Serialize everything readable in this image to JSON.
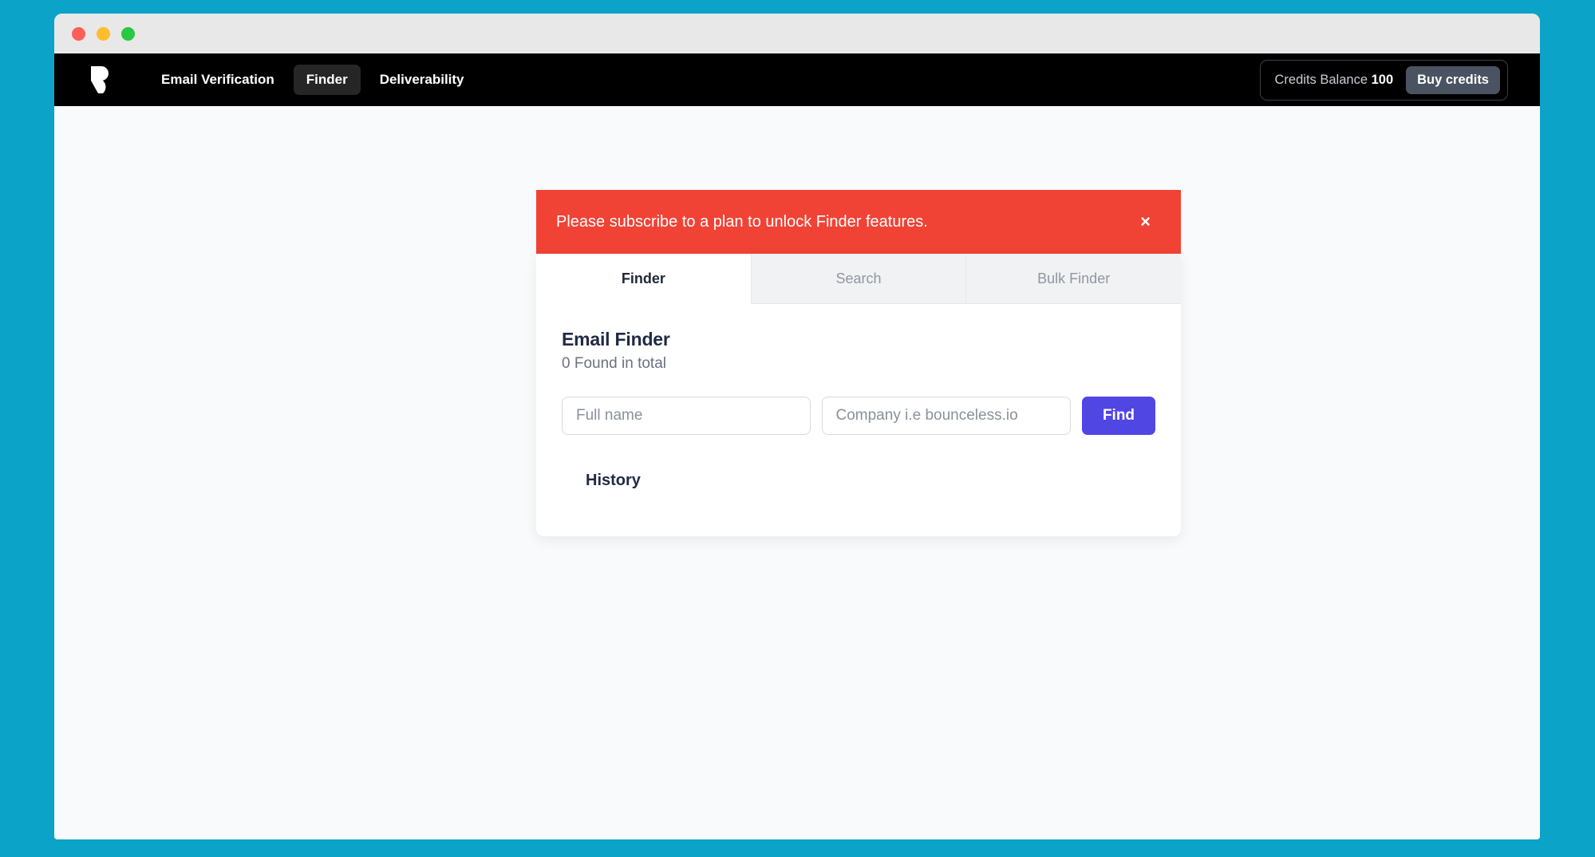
{
  "window": {
    "traffic_lights": [
      {
        "name": "close",
        "color": "#ff5f57"
      },
      {
        "name": "minimize",
        "color": "#febc2e"
      },
      {
        "name": "zoom",
        "color": "#28c840"
      }
    ]
  },
  "header": {
    "logo_name": "bounceless-logo",
    "nav": [
      {
        "label": "Email Verification",
        "active": false
      },
      {
        "label": "Finder",
        "active": true
      },
      {
        "label": "Deliverability",
        "active": false
      }
    ],
    "credits": {
      "label": "Credits Balance",
      "value": "100",
      "buy_label": "Buy credits"
    }
  },
  "alert": {
    "message": "Please subscribe to a plan to unlock Finder features.",
    "close_icon": "×",
    "background": "#f04335"
  },
  "card": {
    "tabs": [
      {
        "label": "Finder",
        "active": true
      },
      {
        "label": "Search",
        "active": false
      },
      {
        "label": "Bulk Finder",
        "active": false
      }
    ],
    "title": "Email Finder",
    "subtitle": "0 Found in total",
    "form": {
      "name_placeholder": "Full name",
      "name_value": "",
      "company_placeholder": "Company i.e bounceless.io",
      "company_value": "",
      "submit_label": "Find"
    },
    "history_label": "History"
  },
  "colors": {
    "desktop": "#0ba3c7",
    "appbar": "#000000",
    "accent": "#5046e4",
    "alert": "#f04335",
    "page": "#f8fafb"
  }
}
